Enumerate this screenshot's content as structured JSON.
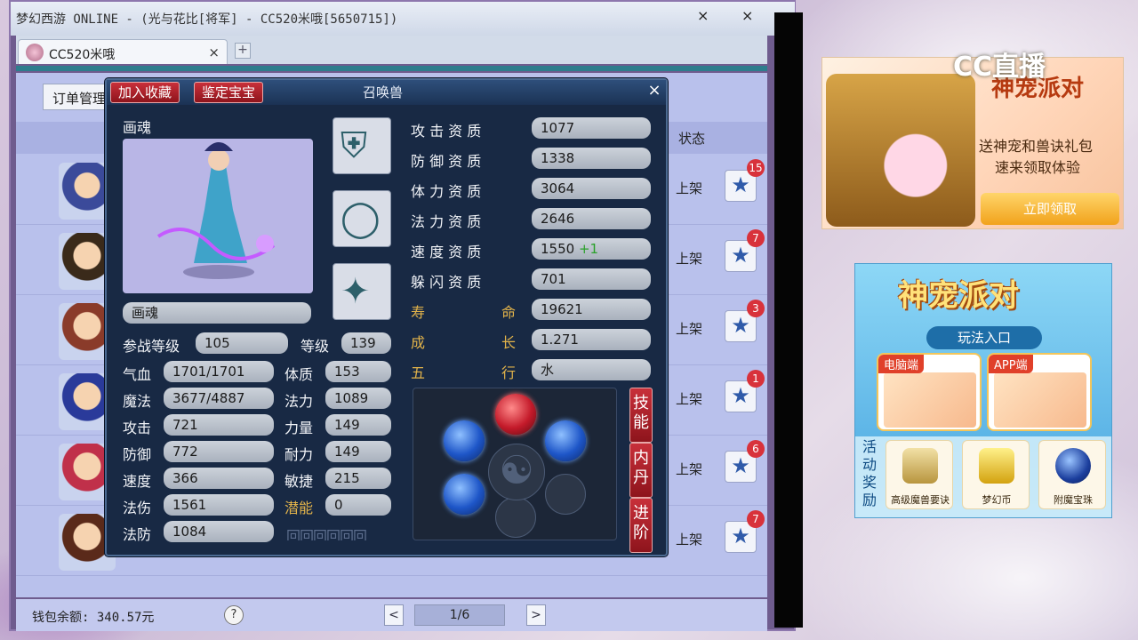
{
  "window": {
    "title": "梦幻西游 ONLINE - (光与花比[将军] - CC520米哦[5650715])",
    "minimize": "×",
    "close": "×"
  },
  "tab": {
    "label": "CC520米哦",
    "close": "×",
    "add": "+"
  },
  "page": {
    "order_button": "订单管理",
    "status_header": "状态",
    "rows": [
      {
        "status": "上架",
        "badge": "15"
      },
      {
        "status": "上架",
        "badge": "7"
      },
      {
        "status": "上架",
        "badge": "3"
      },
      {
        "status": "上架",
        "badge": "1"
      },
      {
        "status": "上架",
        "badge": "6"
      },
      {
        "status": "上架",
        "badge": "7"
      }
    ],
    "wallet": "钱包余额: 340.57元",
    "help": "?",
    "pager": {
      "prev": "<",
      "page": "1/6",
      "next": ">"
    }
  },
  "dialog": {
    "btn_favorite": "加入收藏",
    "btn_appraise": "鉴定宝宝",
    "title": "召唤兽",
    "close": "×",
    "pet_name_label": "画魂",
    "pet_name_field": "画魂",
    "battle_level_label": "参战等级",
    "battle_level": "105",
    "level_label": "等级",
    "level": "139",
    "stats_left": [
      {
        "label": "气血",
        "value": "1701/1701"
      },
      {
        "label": "魔法",
        "value": "3677/4887"
      },
      {
        "label": "攻击",
        "value": "721"
      },
      {
        "label": "防御",
        "value": "772"
      },
      {
        "label": "速度",
        "value": "366"
      },
      {
        "label": "法伤",
        "value": "1561"
      },
      {
        "label": "法防",
        "value": "1084"
      }
    ],
    "stats_right": [
      {
        "label": "体质",
        "value": "153"
      },
      {
        "label": "法力",
        "value": "1089"
      },
      {
        "label": "力量",
        "value": "149"
      },
      {
        "label": "耐力",
        "value": "149"
      },
      {
        "label": "敏捷",
        "value": "215"
      },
      {
        "label": "潜能",
        "value": "0"
      }
    ],
    "aptitudes": [
      {
        "label": "攻 击 资 质",
        "value": "1077"
      },
      {
        "label": "防 御 资 质",
        "value": "1338"
      },
      {
        "label": "体 力 资 质",
        "value": "3064"
      },
      {
        "label": "法 力 资 质",
        "value": "2646"
      },
      {
        "label": "速 度 资 质",
        "value": "1550",
        "bonus": "+1"
      },
      {
        "label": "躲 闪 资 质",
        "value": "701"
      }
    ],
    "life_label_a": "寿",
    "life_label_b": "命",
    "life": "19621",
    "growth_label_a": "成",
    "growth_label_b": "长",
    "growth": "1.271",
    "element_label_a": "五",
    "element_label_b": "行",
    "element": "水",
    "side_skill": "技能",
    "side_neidan": "内丹",
    "side_advance": "进阶",
    "equip_icons": [
      "armor-icon",
      "ring-icon",
      "collar-icon"
    ],
    "yin_yang": "☯",
    "greek": "回回回回回回"
  },
  "ads": {
    "cc_logo": "CC直播",
    "ad1_title": "神宠派对",
    "ad1_line1": "送神宠和兽诀礼包",
    "ad1_line2": "速来领取体验",
    "ad1_button": "立即领取",
    "ad2_title": "神宠派对",
    "ad2_subtitle": "玩法入口",
    "ad2_card_pc": "电脑端",
    "ad2_card_app": "APP端",
    "ad2_side": "活动奖励",
    "rewards": [
      "高级魔兽要诀",
      "梦幻币",
      "附魔宝珠"
    ]
  },
  "colors": {
    "dialog_bg": "#182944",
    "red_button": "#c8303a",
    "gold_label": "#e2b34a",
    "page_bg": "#b9c1ec"
  }
}
